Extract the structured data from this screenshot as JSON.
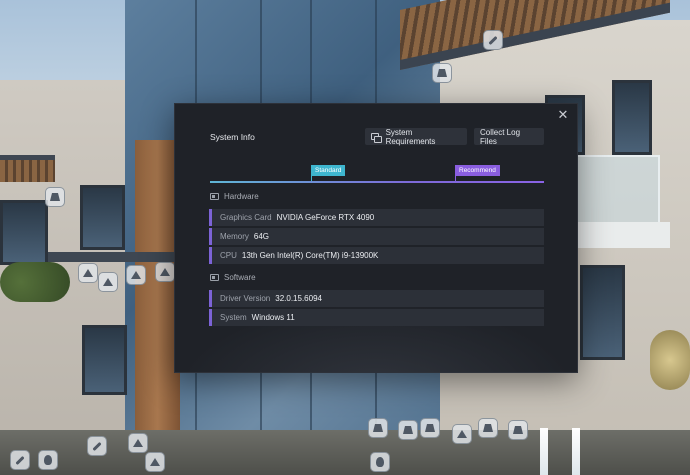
{
  "dialog": {
    "title": "System Info",
    "close_icon": "close-icon",
    "buttons": {
      "system_requirements": "System Requirements",
      "collect_logs": "Collect Log Files"
    },
    "tiers": {
      "standard": "Standard",
      "recommend": "Recommend"
    },
    "hardware": {
      "heading": "Hardware",
      "rows": [
        {
          "label": "Graphics Card",
          "value": "NVIDIA GeForce RTX 4090"
        },
        {
          "label": "Memory",
          "value": "64G"
        },
        {
          "label": "CPU",
          "value": "13th Gen Intel(R) Core(TM) i9-13900K"
        }
      ]
    },
    "software": {
      "heading": "Software",
      "rows": [
        {
          "label": "Driver Version",
          "value": "32.0.15.6094"
        },
        {
          "label": "System",
          "value": "Windows 11"
        }
      ]
    }
  },
  "colors": {
    "dialog_bg": "#1f2228",
    "row_bg": "#2c3038",
    "row_accent": "#7c63d6",
    "standard_tag": "#3eb6cf",
    "recommend_tag": "#8a5ee0"
  },
  "background_hotspots": [
    "hotspot-marker-icon"
  ]
}
